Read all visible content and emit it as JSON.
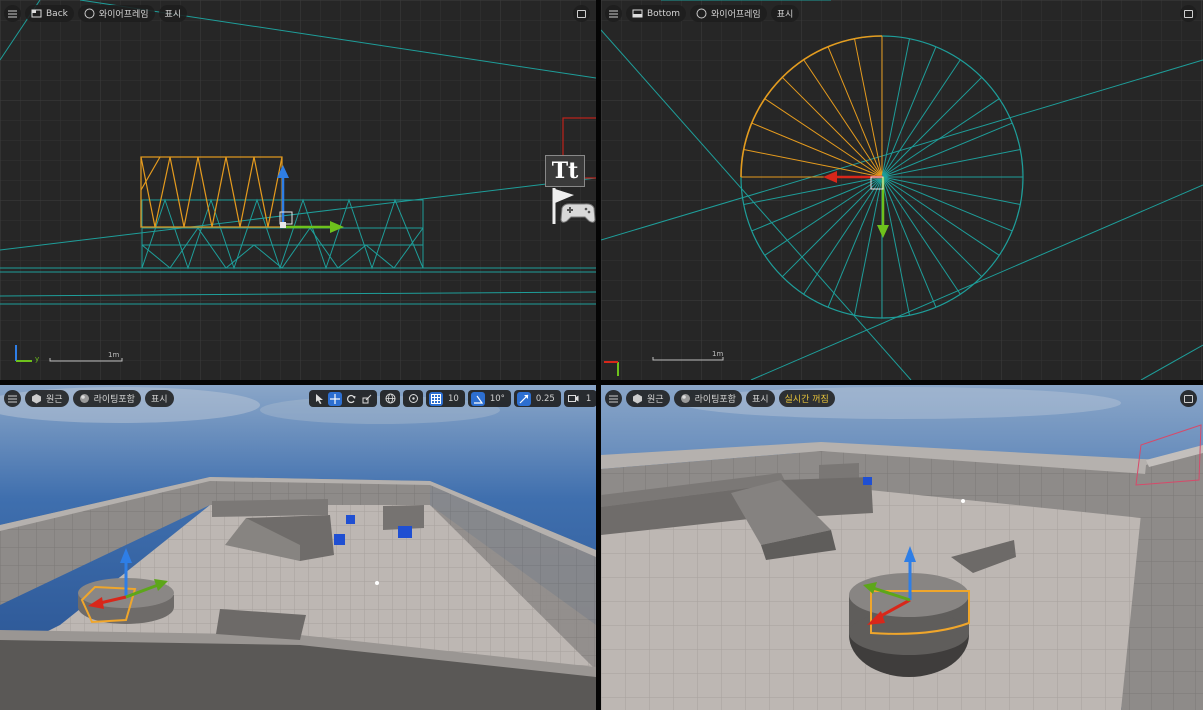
{
  "viewports": {
    "back": {
      "menu_icon": "hamburger-icon",
      "view_label": "Back",
      "mode_label": "와이어프레임",
      "show_label": "표시",
      "scale_label": "1m",
      "axis_label": "y"
    },
    "bottom": {
      "menu_icon": "hamburger-icon",
      "view_label": "Bottom",
      "mode_label": "와이어프레임",
      "show_label": "표시",
      "scale_label": "1m"
    },
    "perspective": {
      "view_label": "원근",
      "mode_label": "라이팅포함",
      "show_label": "표시",
      "grid_snap": "10",
      "rotation_snap": "10°",
      "scale_snap": "0.25",
      "camera_speed": "1"
    },
    "realtime": {
      "view_label": "원근",
      "mode_label": "라이팅포함",
      "show_label": "표시",
      "realtime_label": "실시간 꺼짐"
    }
  },
  "overlay_icons": {
    "text_actor_glyph": "Tt",
    "icons": [
      "text-render-icon",
      "player-start-flag-icon",
      "gamepad-icon"
    ]
  },
  "colors": {
    "wire_teal": "#1e9e9a",
    "wire_orange": "#e59b1e",
    "grid_bg": "#2a2a2a",
    "gizmo_x": "#d8271a",
    "gizmo_y": "#6ec21c",
    "gizmo_z": "#2e7ee6",
    "sky": "#4a77b0",
    "floor": "#bdb7b3"
  }
}
